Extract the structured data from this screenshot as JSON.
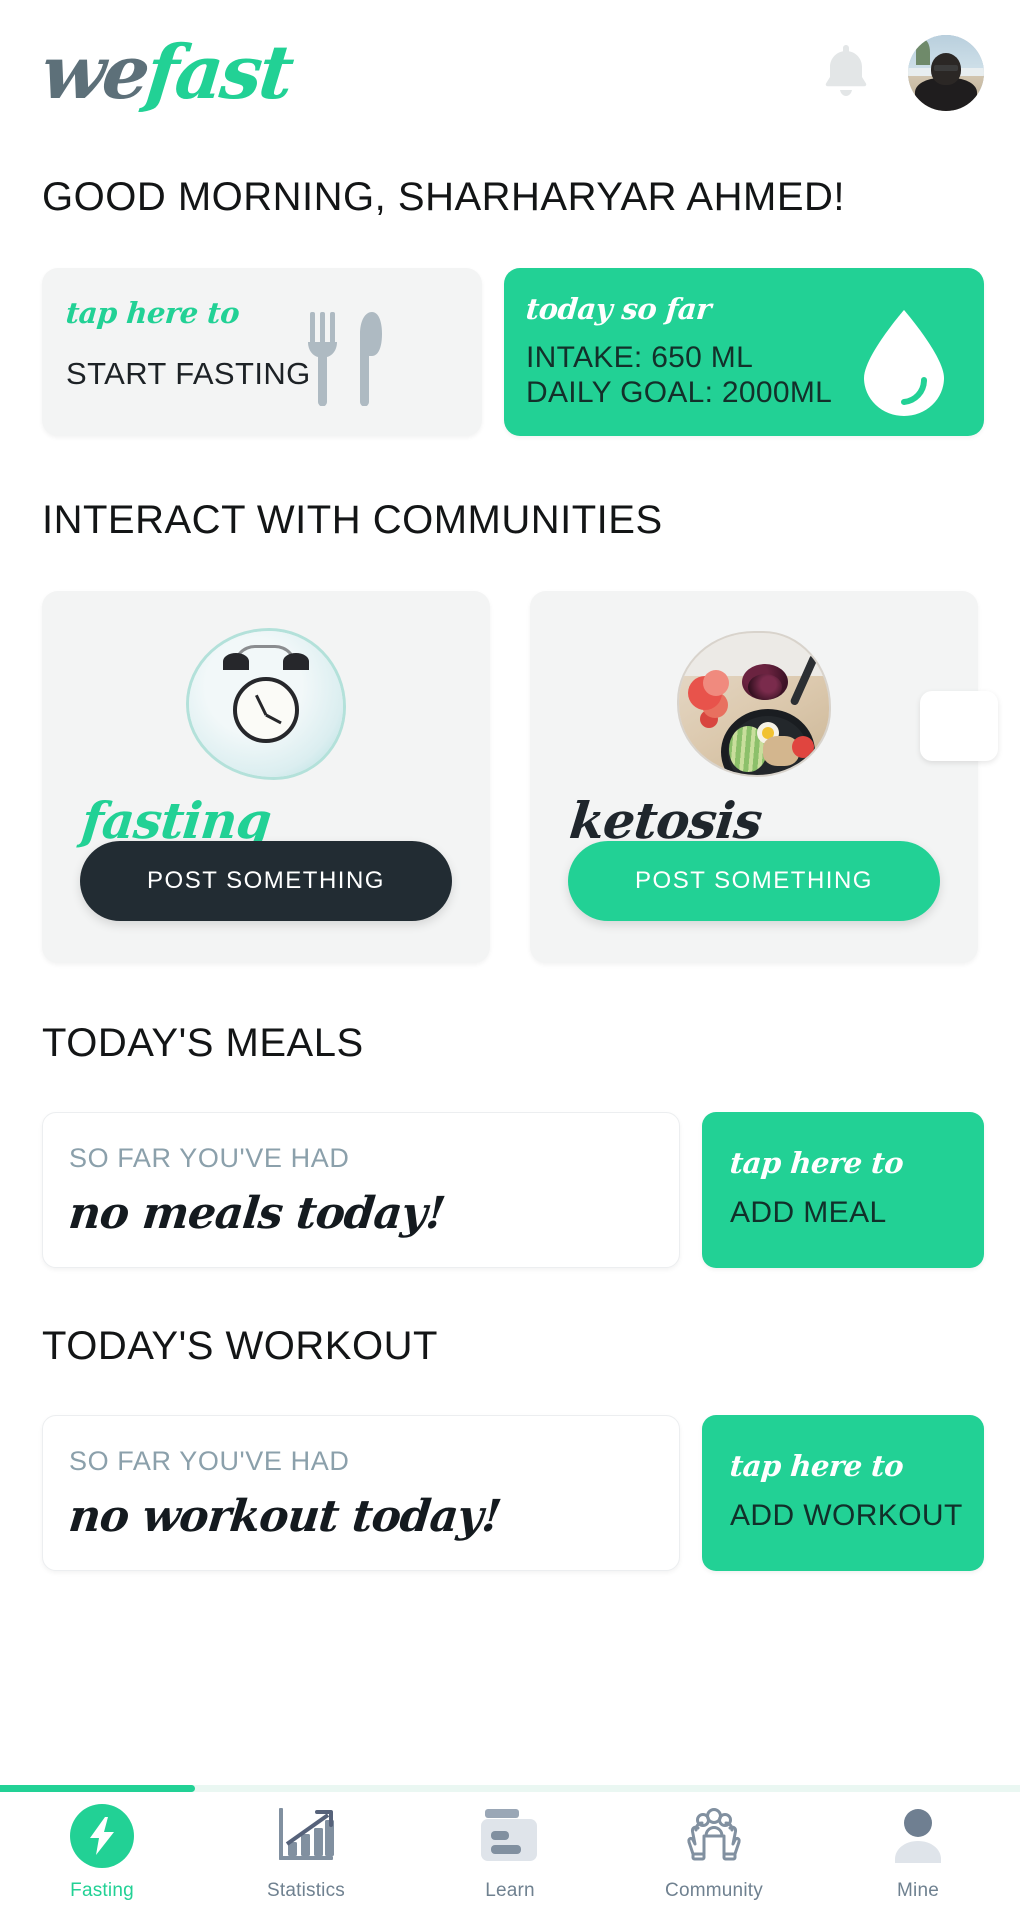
{
  "header": {
    "logo_we": "we",
    "logo_fast": "fast",
    "bell_icon": "bell-icon",
    "avatar_alt": "user-avatar"
  },
  "greeting": "GOOD MORNING, SHARHARYAR AHMED!",
  "fasting_card": {
    "tap_label": "tap here to",
    "action": "START FASTING",
    "icon": "cutlery-icon"
  },
  "water_card": {
    "tap_label": "today so far",
    "intake": "INTAKE: 650 ML",
    "goal": "DAILY GOAL: 2000ML",
    "icon": "water-droplet-icon"
  },
  "communities": {
    "title": "INTERACT WITH COMMUNITIES",
    "cards": [
      {
        "name": "fasting",
        "button": "POST SOMETHING",
        "image": "alarm-clock-image"
      },
      {
        "name": "ketosis",
        "button": "POST SOMETHING",
        "image": "keto-food-bowl-image"
      }
    ]
  },
  "meals": {
    "title": "TODAY'S MEALS",
    "sub": "SO FAR YOU'VE HAD",
    "value": "no meals today!",
    "add_tap": "tap here to",
    "add_action": "ADD MEAL"
  },
  "workout": {
    "title": "TODAY'S WORKOUT",
    "sub": "SO FAR YOU'VE HAD",
    "value": "no workout today!",
    "add_tap": "tap here to",
    "add_action": "ADD WORKOUT"
  },
  "bottom_nav": {
    "items": [
      {
        "label": "Fasting",
        "icon": "lightning-bolt-icon",
        "active": true
      },
      {
        "label": "Statistics",
        "icon": "bar-chart-arrow-icon",
        "active": false
      },
      {
        "label": "Learn",
        "icon": "article-card-icon",
        "active": false
      },
      {
        "label": "Community",
        "icon": "hands-people-icon",
        "active": false
      },
      {
        "label": "Mine",
        "icon": "person-icon",
        "active": false
      }
    ]
  },
  "colors": {
    "accent_green": "#22d195",
    "dark_navy": "#222c33",
    "muted_text": "#8ba0ab",
    "card_grey": "#f3f4f4"
  }
}
